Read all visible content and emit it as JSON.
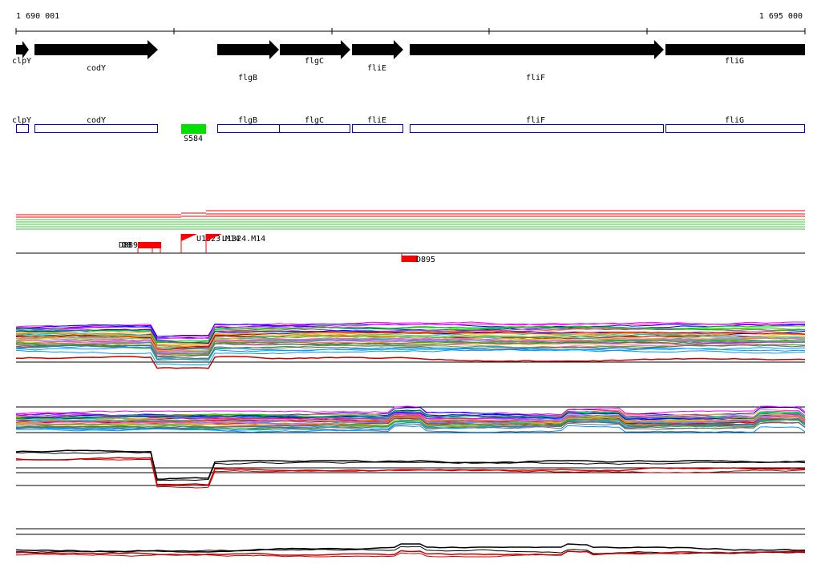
{
  "ruler": {
    "start_label": "1 690 001",
    "end_label": "1 695 000"
  },
  "genes_arrows": [
    {
      "name": "clpY"
    },
    {
      "name": "codY"
    },
    {
      "name": "flgB"
    },
    {
      "name": "flgC"
    },
    {
      "name": "fliE"
    },
    {
      "name": "fliF"
    },
    {
      "name": "fliG"
    }
  ],
  "genes_boxes": [
    {
      "name": "clpY"
    },
    {
      "name": "codY"
    },
    {
      "name": "flgB"
    },
    {
      "name": "flgC"
    },
    {
      "name": "fliE"
    },
    {
      "name": "fliF"
    },
    {
      "name": "fliG"
    }
  ],
  "green_feature": {
    "label": "S584",
    "color": "#00e000"
  },
  "red_features": [
    {
      "label": "D889"
    },
    {
      "label": "U1323.M14"
    },
    {
      "label": "U1324.M14"
    },
    {
      "label": "D895"
    }
  ],
  "colors": {
    "gene_arrow": "#000000",
    "gene_box_stroke": "#0000cc",
    "feature_red": "#ff0000",
    "track_line": "#000000"
  }
}
